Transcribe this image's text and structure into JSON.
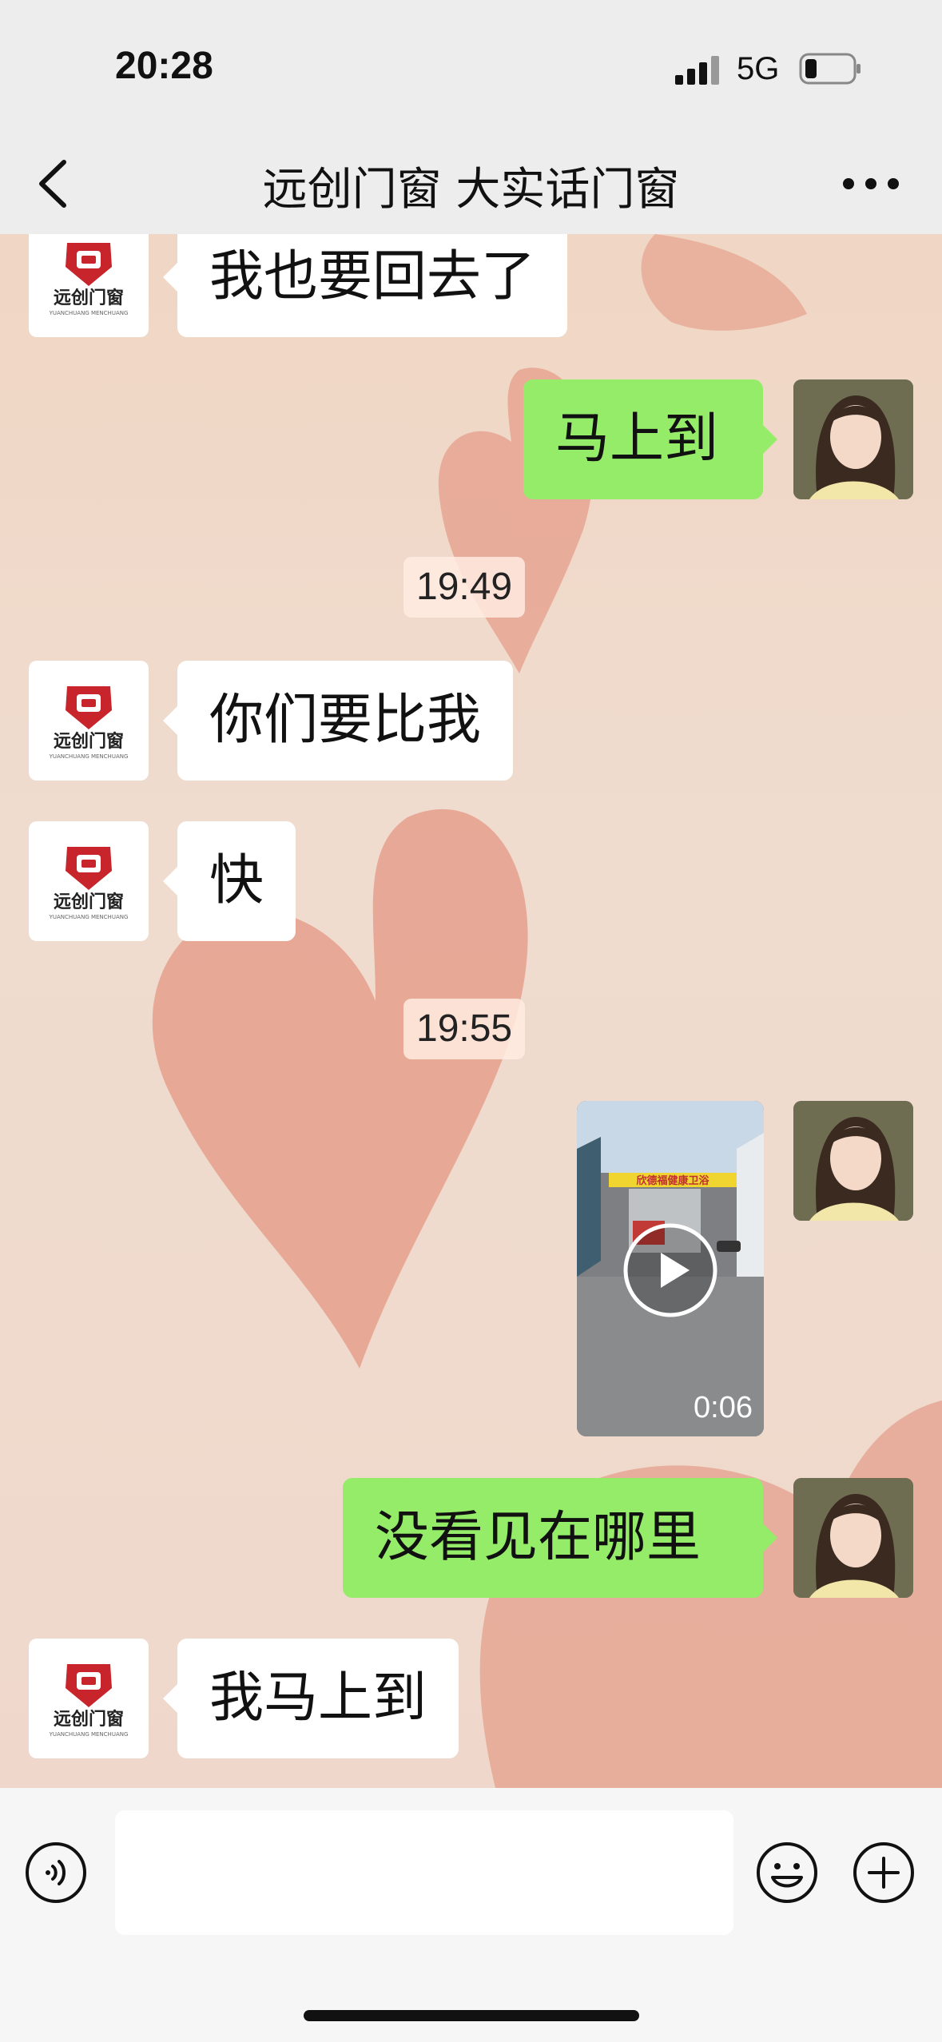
{
  "status_bar": {
    "time": "20:28",
    "network": "5G"
  },
  "nav": {
    "title": "远创门窗  大实话门窗"
  },
  "brand": {
    "logo_main": "远创门窗",
    "logo_sub": "YUANCHUANG MENCHUANG"
  },
  "messages": {
    "m1": "我也要回去了",
    "m2": "马上到",
    "ts1": "19:49",
    "m3": "你们要比我",
    "m4": "快",
    "ts2": "19:55",
    "video_duration": "0:06",
    "video_banner": "欣德福健康卫浴",
    "m5": "没看见在哪里",
    "m6": "我马上到"
  },
  "input": {
    "placeholder": ""
  },
  "colors": {
    "sent_bubble": "#95ec69",
    "received_bubble": "#ffffff",
    "brand_red": "#c8242b"
  }
}
